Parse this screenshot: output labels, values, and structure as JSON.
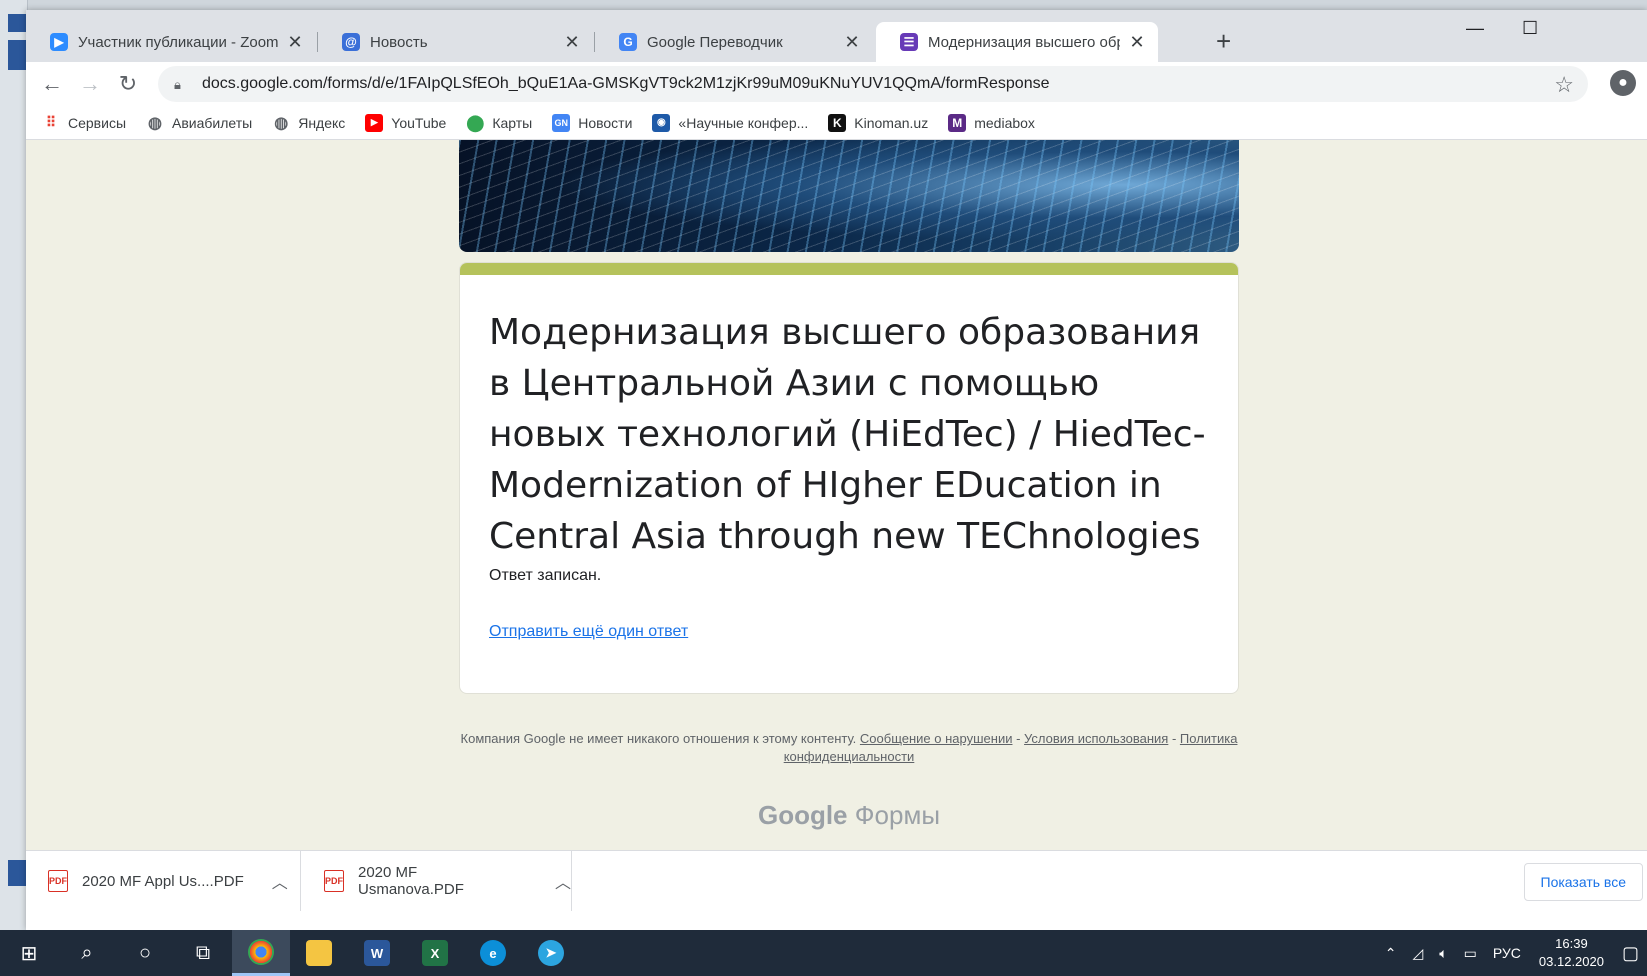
{
  "tabs": [
    {
      "label": "Участник публикации - Zoom",
      "icon": "zoom-icon",
      "color": "#2d8cff"
    },
    {
      "label": "Новость",
      "icon": "mail-at-icon",
      "color": "#3a6fd8"
    },
    {
      "label": "Google Переводчик",
      "icon": "translate-icon",
      "color": "#4285f4"
    },
    {
      "label": "Модернизация высшего образо",
      "icon": "google-forms-icon",
      "color": "#673ab7"
    }
  ],
  "address": {
    "url": "docs.google.com/forms/d/e/1FAIpQLSfEOh_bQuE1Aa-GMSKgVT9ck2M1zjKr99uM09uKNuYUV1QQmA/formResponse"
  },
  "bookmarks": [
    {
      "label": "Сервисы",
      "icon": "apps-grid-icon",
      "color": "#e94235"
    },
    {
      "label": "Авиабилеты",
      "icon": "globe-icon",
      "color": "#5f6368"
    },
    {
      "label": "Яндекс",
      "icon": "globe-icon",
      "color": "#5f6368"
    },
    {
      "label": "YouTube",
      "icon": "youtube-icon",
      "color": "#ff0000"
    },
    {
      "label": "Карты",
      "icon": "maps-pin-icon",
      "color": "#34a853"
    },
    {
      "label": "Новости",
      "icon": "google-news-icon",
      "color": "#4285f4"
    },
    {
      "label": "«Научные конфер...",
      "icon": "site-icon",
      "color": "#1e5aa8"
    },
    {
      "label": "Kinoman.uz",
      "icon": "k-logo-icon",
      "color": "#111111"
    },
    {
      "label": "mediabox",
      "icon": "mediabox-icon",
      "color": "#5b2a86"
    }
  ],
  "form": {
    "accent_color": "#b5c25b",
    "title": "Модернизация высшего образования в Центральной Азии с помощью новых технологий (HiEdTec) / HiedTec- Modernization of HIgher EDucation in Central Asia through new TEChnologies",
    "status": "Ответ записан.",
    "another_link": "Отправить ещё один ответ"
  },
  "footer": {
    "disclaimer": "Компания Google не имеет никакого отношения к этому контенту.",
    "report": "Сообщение о нарушении",
    "sep1": " - ",
    "terms": "Условия использования",
    "sep2": " - ",
    "privacy": "Политика конфиденциальности",
    "brand_google": "Google",
    "brand_forms": "Формы"
  },
  "downloads": [
    {
      "name": "2020 MF Appl Us....PDF"
    },
    {
      "name": "2020 MF Usmanova.PDF"
    }
  ],
  "show_all": "Показать все",
  "tray": {
    "lang": "РУС",
    "time": "16:39",
    "date": "03.12.2020"
  }
}
